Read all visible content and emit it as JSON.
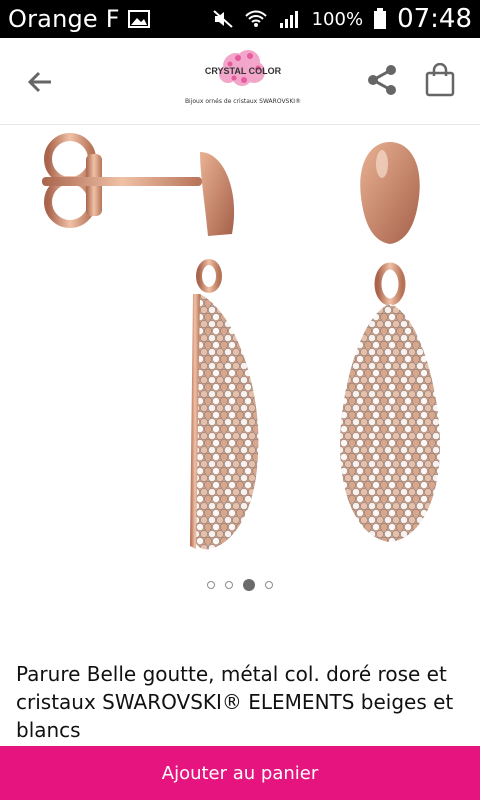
{
  "status_bar": {
    "carrier": "Orange F",
    "battery": "100%",
    "time": "07:48",
    "icons": [
      "gallery-icon",
      "mute-icon",
      "wifi-icon",
      "signal-icon",
      "battery-icon"
    ]
  },
  "app_bar": {
    "logo_text": "CRYSTAL COLOR",
    "logo_tagline": "Bijoux ornés de cristaux SWAROVSKI®",
    "icons": [
      "back-arrow-icon",
      "share-icon",
      "shopping-bag-icon"
    ]
  },
  "gallery": {
    "pages": 4,
    "current_page_index": 2
  },
  "product": {
    "title": "Parure Belle goutte, métal col. doré rose et cristaux SWAROVSKI® ELEMENTS beiges et blancs"
  },
  "actions": {
    "add_to_cart": "Ajouter au panier"
  },
  "colors": {
    "status_bar_bg": "#000000",
    "accent_pink": "#e5147e",
    "rose_gold": "#c98b6c",
    "text": "#111111"
  }
}
